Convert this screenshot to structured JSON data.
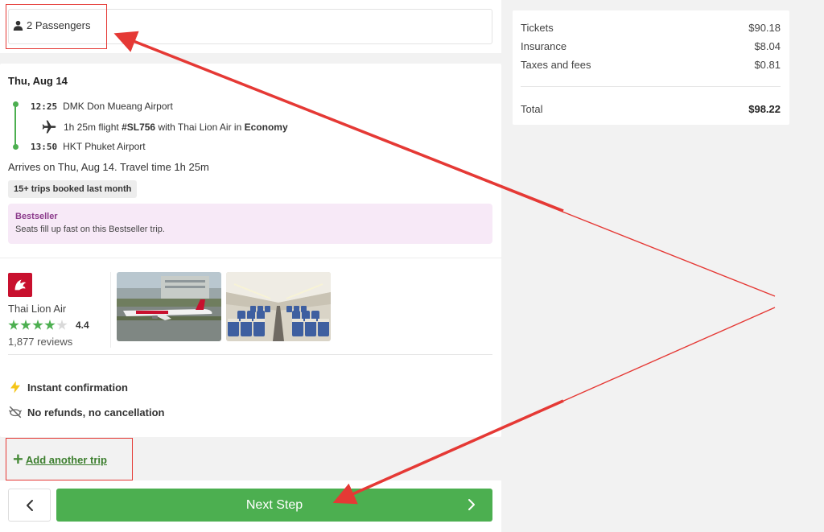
{
  "passengers": {
    "label": "2 Passengers",
    "icon": "person-icon"
  },
  "trip": {
    "date": "Thu, Aug 14",
    "departure": {
      "time": "12:25",
      "airport": "DMK Don Mueang Airport"
    },
    "flight": {
      "duration": "1h 25m flight",
      "number": "#SL756",
      "with": "with Thai Lion Air in",
      "class": "Economy",
      "icon": "airplane-icon"
    },
    "arrival": {
      "time": "13:50",
      "airport": "HKT Phuket Airport"
    },
    "arrives_text": "Arrives on Thu, Aug 14. Travel time 1h 25m",
    "trips_badge": "15+ trips booked last month",
    "bestseller": {
      "title": "Bestseller",
      "desc": "Seats fill up fast on this Bestseller trip."
    }
  },
  "airline": {
    "name": "Thai Lion Air",
    "rating": "4.4",
    "rating_value": 4.4,
    "rating_max": 5,
    "reviews": "1,877 reviews",
    "logo_color": "#c8102e"
  },
  "features": [
    {
      "label": "Instant confirmation",
      "icon": "lightning-icon"
    },
    {
      "label": "No refunds, no cancellation",
      "icon": "no-refund-icon"
    }
  ],
  "add_trip": {
    "label": "Add another trip"
  },
  "nav": {
    "next_label": "Next Step"
  },
  "summary": {
    "rows": [
      {
        "label": "Tickets",
        "value": "$90.18"
      },
      {
        "label": "Insurance",
        "value": "$8.04"
      },
      {
        "label": "Taxes and fees",
        "value": "$0.81"
      }
    ],
    "total": {
      "label": "Total",
      "value": "$98.22"
    }
  },
  "colors": {
    "accent": "#4caf50",
    "annotation": "#e53935",
    "bestseller_bg": "#f7e9f7",
    "bestseller_title": "#8c3b8c"
  }
}
